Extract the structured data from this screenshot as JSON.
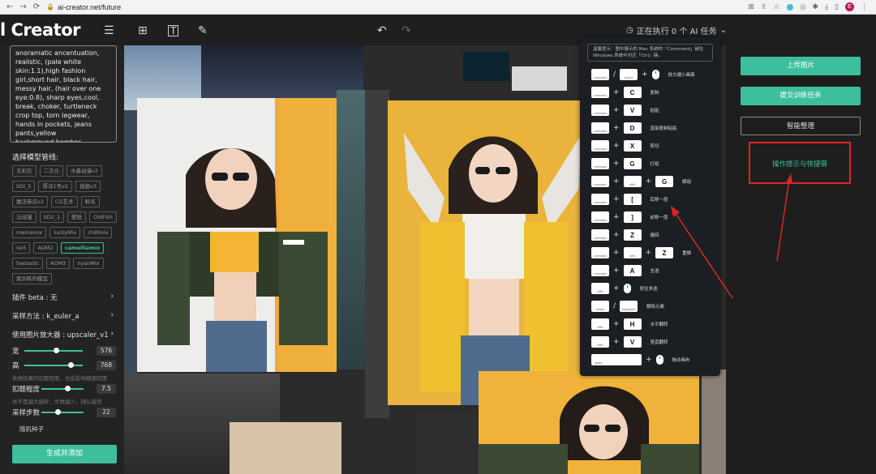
{
  "browser": {
    "url": "ai-creator.net/future",
    "avatar_letter": "E"
  },
  "header": {
    "logo": "l Creator",
    "task_status": "正在执行 0 个 AI 任务"
  },
  "left": {
    "prompt_text": "anoramatic ancentuation, realistic, (pale white skin:1.1),high fashion girl,short hair, black hair, messy hair, (hair over one eye:0.8), sharp eyes,cool, break, choker, turtleneck crop top, torn legwear, hands in pockets, jeans pants,yellow background,bomber jacket,cargo,yeezy,sunglass,",
    "model_title": "选择模型管线:",
    "models": [
      {
        "label": "五彩石",
        "active": false
      },
      {
        "label": "二次元",
        "active": false
      },
      {
        "label": "水墨动漫v2",
        "active": false
      },
      {
        "label": "SDI_5",
        "active": false
      },
      {
        "label": "厚涂1号v2",
        "active": false
      },
      {
        "label": "插画v3",
        "active": false
      },
      {
        "label": "魔法麻瓜v2",
        "active": false
      },
      {
        "label": "CG艺术",
        "active": false
      },
      {
        "label": "粉毛",
        "active": false
      },
      {
        "label": "泛动漫",
        "active": false
      },
      {
        "label": "SD2_1",
        "active": false
      },
      {
        "label": "壁纸",
        "active": false
      },
      {
        "label": "OldFish",
        "active": false
      },
      {
        "label": "meinamix",
        "active": false
      },
      {
        "label": "luckyMix",
        "active": false
      },
      {
        "label": "chillmix",
        "active": false
      },
      {
        "label": "rei5",
        "active": false
      },
      {
        "label": "AOM2",
        "active": false
      },
      {
        "label": "camelliamix",
        "active": true
      },
      {
        "label": "faetastic",
        "active": false
      },
      {
        "label": "AOM3",
        "active": false
      },
      {
        "label": "nyanMix",
        "active": false
      },
      {
        "label": "我训练的模型",
        "active": false
      }
    ],
    "plugin": "插件 beta : 无",
    "sampler": "采样方法 : k_euler_a",
    "upscaler": "使用图片放大器 : upscaler_v1",
    "width_label": "宽",
    "width_value": "576",
    "width_level": 0.55,
    "height_label": "高",
    "height_value": "768",
    "height_level": 0.8,
    "hint1": "依据结果的扣题程度，也会影响精细程度",
    "guidance_label": "扣题程度",
    "guidance_value": "7.5",
    "guidance_level": 0.62,
    "hint2": "并不是越大越好，步数越少，排队越快",
    "steps_label": "采样步数",
    "steps_value": "22",
    "steps_level": 0.4,
    "seed_label": "随机种子",
    "generate_label": "生成并添加"
  },
  "shortcuts": {
    "note": "温馨提示：图中展示的 Mac 系统的「Command」键在 Windows 系统中对应「Ctrl」键。",
    "items": [
      {
        "keys": [
          "command",
          "/",
          "control",
          "+",
          "mouse"
        ],
        "label": "放大缩小画面"
      },
      {
        "keys": [
          "command",
          "+",
          "C"
        ],
        "label": "复制"
      },
      {
        "keys": [
          "command",
          "+",
          "V"
        ],
        "label": "粘贴"
      },
      {
        "keys": [
          "command",
          "+",
          "D"
        ],
        "label": "直接复制粘贴"
      },
      {
        "keys": [
          "command",
          "+",
          "X"
        ],
        "label": "剪切"
      },
      {
        "keys": [
          "command",
          "+",
          "G"
        ],
        "label": "打组"
      },
      {
        "keys": [
          "command",
          "+",
          "shift",
          "+",
          "G"
        ],
        "label": "解组"
      },
      {
        "keys": [
          "command",
          "+",
          "["
        ],
        "label": "后移一层"
      },
      {
        "keys": [
          "command",
          "+",
          "]"
        ],
        "label": "前移一层"
      },
      {
        "keys": [
          "command",
          "+",
          "Z"
        ],
        "label": "撤回"
      },
      {
        "keys": [
          "command",
          "+",
          "shift",
          "+",
          "Z"
        ],
        "label": "重做"
      },
      {
        "keys": [
          "command",
          "+",
          "A"
        ],
        "label": "全选"
      },
      {
        "keys": [
          "shift",
          "+",
          "mouse"
        ],
        "label": "按住多选"
      },
      {
        "keys": [
          "delete",
          "/",
          "backspace"
        ],
        "label": "删除元素"
      },
      {
        "keys": [
          "shift",
          "+",
          "H"
        ],
        "label": "水平翻转"
      },
      {
        "keys": [
          "shift",
          "+",
          "V"
        ],
        "label": "竖直翻转"
      },
      {
        "keys": [
          "space",
          "+",
          "mouse"
        ],
        "label": "拖动画布"
      }
    ]
  },
  "right": {
    "upload_label": "上传图片",
    "train_label": "提交训练任务",
    "organize_label": "智能整理",
    "shortcut_link": "操作提示与快捷键"
  },
  "colors": {
    "accent": "#3dbf9d",
    "highlight_red": "#e02424"
  }
}
